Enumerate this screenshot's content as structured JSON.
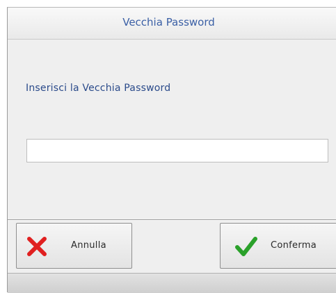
{
  "dialog": {
    "title": "Vecchia Password",
    "prompt": "Inserisci la Vecchia Password",
    "password_field": {
      "value": "",
      "placeholder": ""
    }
  },
  "buttons": {
    "cancel_label": "Annulla",
    "cancel_icon": "x-icon",
    "confirm_label": "Conferma",
    "confirm_icon": "checkmark-icon"
  },
  "colors": {
    "title_text": "#3a5fa5",
    "prompt_text": "#2a4a8a",
    "cancel_icon": "#e02020",
    "confirm_icon": "#2aa12a",
    "dialog_background": "#efefef"
  }
}
